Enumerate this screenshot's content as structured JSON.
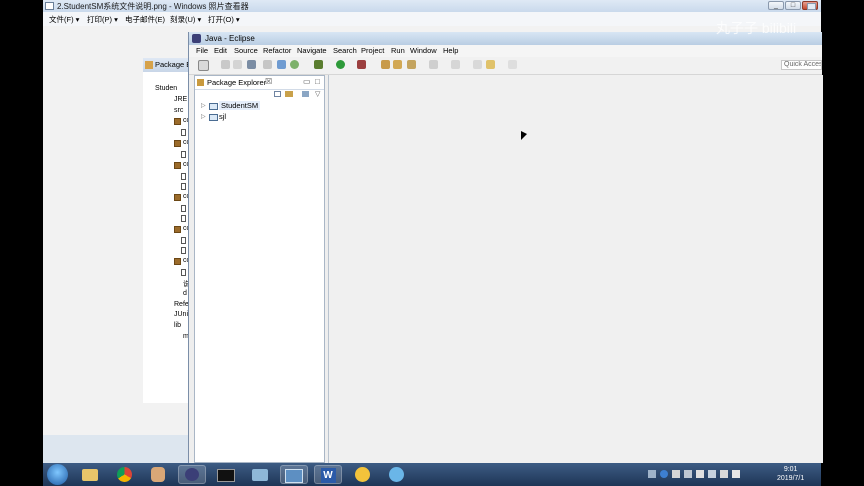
{
  "viewer": {
    "title": "2.StudentSM系统文件说明.png - Windows 照片查看器",
    "menu": [
      "文件(F) ▾",
      "打印(P) ▾",
      "电子邮件(E)",
      "刻录(U) ▾",
      "打开(O) ▾"
    ],
    "help_glyph": "?",
    "image_panel": {
      "header": "Package E",
      "rows": [
        "Studen",
        "JRE",
        "src",
        "co",
        "co",
        "co",
        "co",
        "co",
        "co",
        "说",
        "d",
        "Refe",
        "JUni",
        "lib",
        "m"
      ]
    }
  },
  "eclipse": {
    "title": "Java - Eclipse",
    "menu": [
      "File",
      "Edit",
      "Source",
      "Refactor",
      "Navigate",
      "Search",
      "Project",
      "Run",
      "Window",
      "Help"
    ],
    "quick_access": "Quick Acces",
    "package_explorer": {
      "tab_label": "Package Explorer",
      "tab_close": "☒",
      "items": [
        "StudentSM",
        "sjl"
      ]
    }
  },
  "taskbar": {
    "apps": [
      "windows-explorer",
      "chrome",
      "avatar-app",
      "eclipse",
      "cmd",
      "app-6",
      "photo-viewer",
      "word",
      "app-9",
      "app-10"
    ],
    "time": "9:01",
    "date": "2019/7/1"
  },
  "watermark": "丸子子 bilibili",
  "colors": {
    "taskbar": "#2a4670",
    "title_bar": "#c9d9ec",
    "editor_bg": "#f0f0f0"
  }
}
